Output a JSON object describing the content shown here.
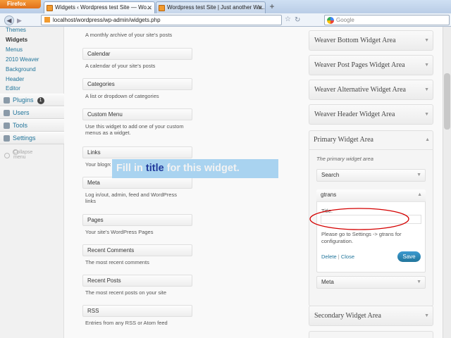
{
  "browser": {
    "menu_button": "Firefox",
    "tabs": [
      {
        "label": "Widgets ‹ Wordpress test Site — Wo..."
      },
      {
        "label": "Wordpress test Site | Just another Wo..."
      }
    ],
    "url": "localhost/wordpress/wp-admin/widgets.php",
    "search_placeholder": "Google"
  },
  "sidebar": {
    "submenu": [
      {
        "label": "Themes"
      },
      {
        "label": "Widgets"
      },
      {
        "label": "Menus"
      },
      {
        "label": "2010 Weaver"
      },
      {
        "label": "Background"
      },
      {
        "label": "Header"
      },
      {
        "label": "Editor"
      }
    ],
    "menu": [
      {
        "label": "Plugins",
        "badge": "1",
        "icon": "plug-icon"
      },
      {
        "label": "Users",
        "icon": "users-icon"
      },
      {
        "label": "Tools",
        "icon": "tools-icon"
      },
      {
        "label": "Settings",
        "icon": "settings-icon"
      }
    ],
    "collapse_label": "Collapse menu"
  },
  "available_widgets": {
    "archives_desc": "A monthly archive of your site's posts",
    "items": [
      {
        "name": "Calendar",
        "desc": "A calendar of your site's posts"
      },
      {
        "name": "Categories",
        "desc": "A list or dropdown of categories"
      },
      {
        "name": "Custom Menu",
        "desc": "Use this widget to add one of your custom menus as a widget."
      },
      {
        "name": "Links",
        "desc": "Your blogroll"
      },
      {
        "name": "Meta",
        "desc": "Log in/out, admin, feed and WordPress links"
      },
      {
        "name": "Pages",
        "desc": "Your site's WordPress Pages"
      },
      {
        "name": "Recent Comments",
        "desc": "The most recent comments"
      },
      {
        "name": "Recent Posts",
        "desc": "The most recent posts on your site"
      },
      {
        "name": "RSS",
        "desc": "Entries from any RSS or Atom feed"
      }
    ]
  },
  "widget_areas": {
    "collapsed_top": [
      {
        "title": "Weaver Bottom Widget Area"
      },
      {
        "title": "Weaver Post Pages Widget Area"
      },
      {
        "title": "Weaver Alternative Widget Area"
      },
      {
        "title": "Weaver Header Widget Area"
      }
    ],
    "primary": {
      "title": "Primary Widget Area",
      "description": "The primary widget area",
      "widgets": [
        {
          "name": "Search"
        },
        {
          "name": "gtrans"
        },
        {
          "name": "Meta"
        }
      ],
      "gtrans_form": {
        "title_label": "Title:",
        "title_value": "",
        "note": "Please go to Settings -> gtrans for configuration.",
        "delete_label": "Delete",
        "separator": "|",
        "close_label": "Close",
        "save_label": "Save"
      }
    },
    "collapsed_bottom": [
      {
        "title": "Secondary Widget Area"
      }
    ]
  },
  "annotation": {
    "before": "Fill in ",
    "keyword": "title",
    "after": " for this widget.",
    "ellipse_color": "#d40000"
  },
  "colors": {
    "link": "#21759b",
    "save_button": "#21759b",
    "annotation_bg": "#a9d3f0",
    "annotation_keyword": "#223b9c"
  }
}
